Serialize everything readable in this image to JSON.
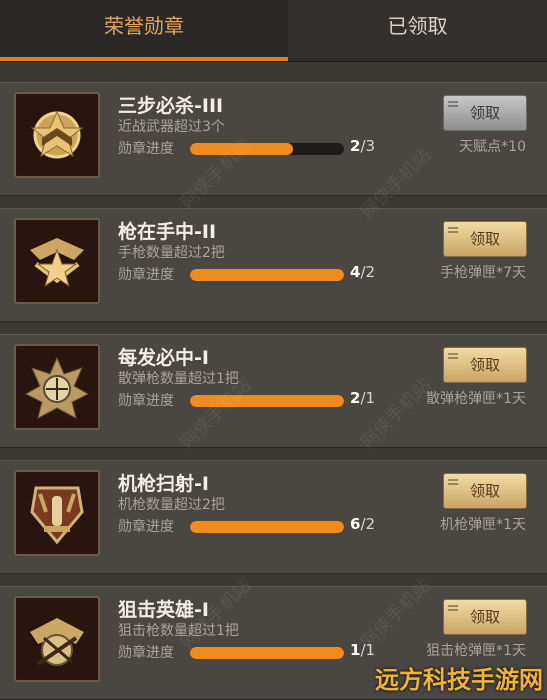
{
  "tabs": [
    {
      "label": "荣誉勋章"
    },
    {
      "label": "已领取"
    }
  ],
  "progress_label": "勋章进度",
  "cards": [
    {
      "title": "三步必杀-III",
      "desc": "近战武器超过3个",
      "progress_current": "2",
      "progress_total": "/3",
      "progress_fraction": 0.67,
      "button": "领取",
      "button_state": "disabled",
      "reward": "天赋点*10"
    },
    {
      "title": "枪在手中-II",
      "desc": "手枪数量超过2把",
      "progress_current": "4",
      "progress_total": "/2",
      "progress_fraction": 1.0,
      "button": "领取",
      "button_state": "enabled",
      "reward": "手枪弹匣*7天"
    },
    {
      "title": "每发必中-I",
      "desc": "散弹枪数量超过1把",
      "progress_current": "2",
      "progress_total": "/1",
      "progress_fraction": 1.0,
      "button": "领取",
      "button_state": "enabled",
      "reward": "散弹枪弹匣*1天"
    },
    {
      "title": "机枪扫射-I",
      "desc": "机枪数量超过2把",
      "progress_current": "6",
      "progress_total": "/2",
      "progress_fraction": 1.0,
      "button": "领取",
      "button_state": "enabled",
      "reward": "机枪弹匣*1天"
    },
    {
      "title": "狙击英雄-I",
      "desc": "狙击枪数量超过1把",
      "progress_current": "1",
      "progress_total": "/1",
      "progress_fraction": 1.0,
      "button": "领取",
      "button_state": "enabled",
      "reward": "狙击枪弹匣*1天"
    }
  ],
  "watermark": "网侠手机站",
  "site_logo": "远方科技手游网",
  "colors": {
    "accent": "#e07d2a",
    "progress": "#ef8b1f",
    "button_gold": "#e3c585",
    "button_gray": "#a8a8a8"
  }
}
